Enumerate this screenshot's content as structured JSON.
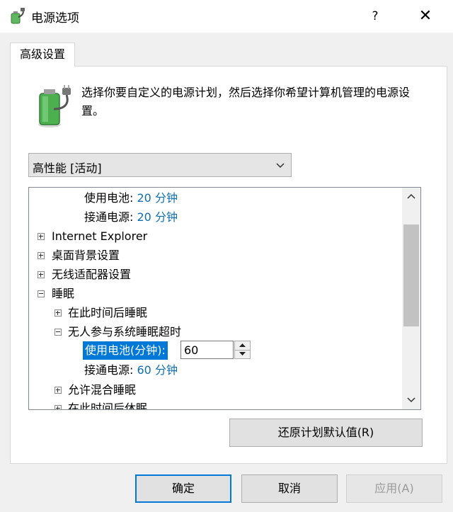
{
  "window": {
    "title": "电源选项",
    "help": "?",
    "close": "✕"
  },
  "tab": {
    "label": "高级设置"
  },
  "description": "选择你要自定义的电源计划，然后选择你希望计算机管理的电源设置。",
  "plan_select": {
    "value": "高性能 [活动]"
  },
  "tree": {
    "top_battery": {
      "label": "使用电池:",
      "value": "20 分钟"
    },
    "top_plugged": {
      "label": "接通电源:",
      "value": "20 分钟"
    },
    "ie": "Internet Explorer",
    "desktop_bg": "桌面背景设置",
    "wireless": "无线适配器设置",
    "sleep": "睡眠",
    "sleep_after": "在此时间后睡眠",
    "unattended": "无人参与系统睡眠超时",
    "unattended_battery_label": "使用电池(分钟):",
    "unattended_battery_value": "60",
    "unattended_plugged": {
      "label": "接通电源:",
      "value": "60 分钟"
    },
    "hybrid_sleep": "允许混合睡眠",
    "hibernate_after": "在此时间后休眠"
  },
  "buttons": {
    "restore": "还原计划默认值(R)",
    "ok": "确定",
    "cancel": "取消",
    "apply": "应用(A)"
  }
}
